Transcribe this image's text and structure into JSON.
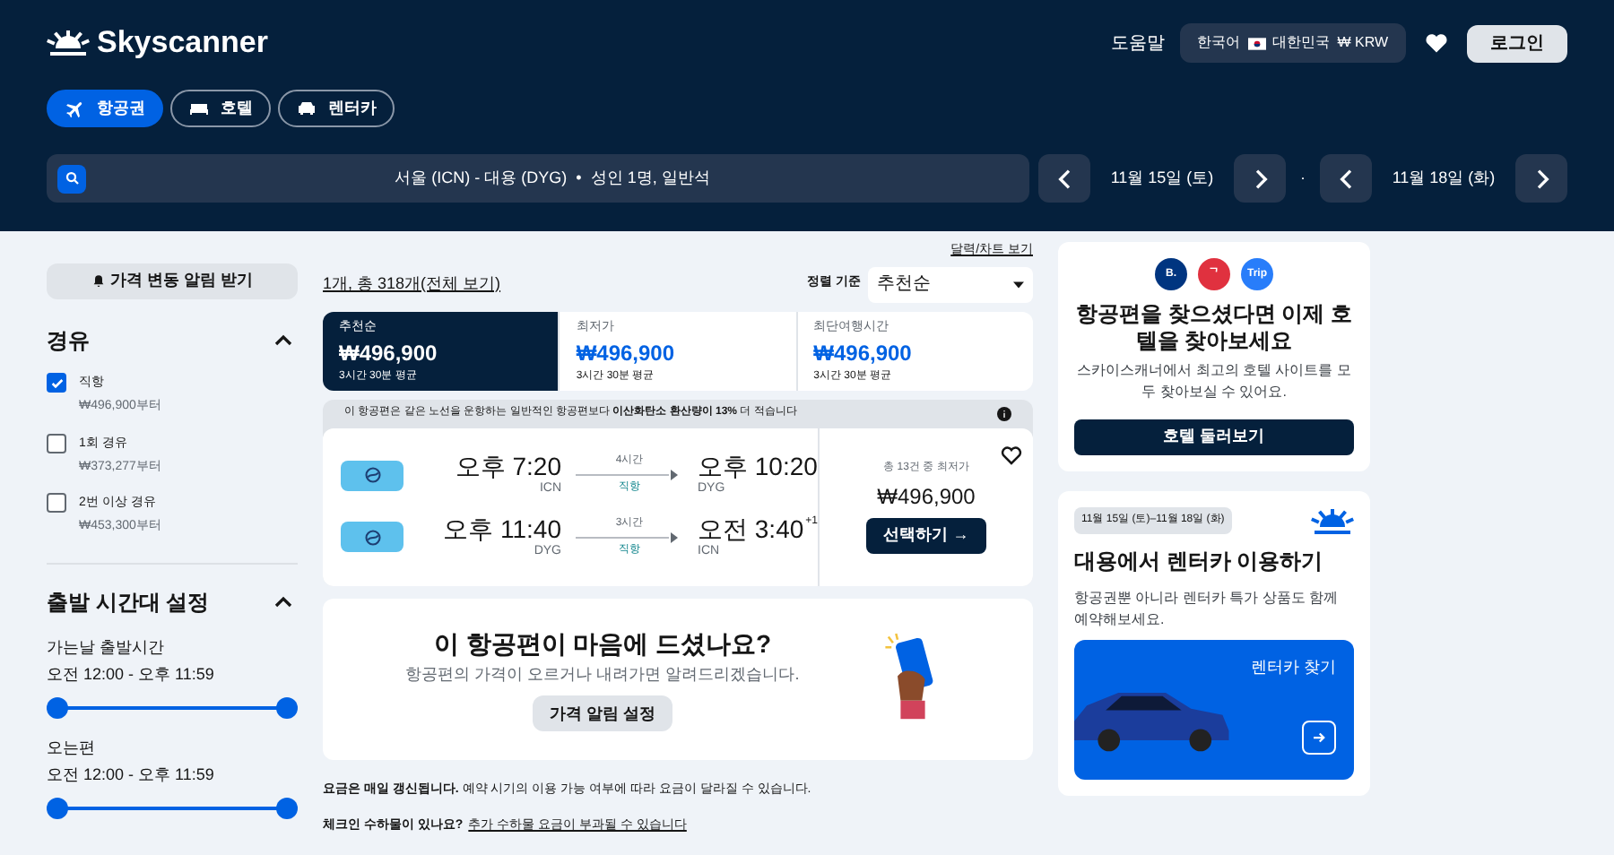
{
  "header": {
    "logo": "Skyscanner",
    "help": "도움말",
    "locale": {
      "language": "한국어",
      "country": "대한민국",
      "currency": "₩ KRW"
    },
    "login": "로그인"
  },
  "nav_tabs": [
    {
      "label": "항공권",
      "selected": true,
      "kind": "plane"
    },
    {
      "label": "호텔",
      "selected": false,
      "kind": "bed"
    },
    {
      "label": "렌터카",
      "selected": false,
      "kind": "car"
    }
  ],
  "search": {
    "summary": "서울 (ICN) - 대용 (DYG)  •  성인 1명, 일반석",
    "depart": "11월 15일 (토)",
    "separator": "·",
    "return": "11월 18일 (화)"
  },
  "sidebar": {
    "alert_button": "가격 변동 알림 받기",
    "stops": {
      "title": "경유",
      "expanded": true,
      "items": [
        {
          "label": "직항",
          "price": "₩496,900부터",
          "checked": true
        },
        {
          "label": "1회 경유",
          "price": "₩373,277부터",
          "checked": false
        },
        {
          "label": "2번 이상 경유",
          "price": "₩453,300부터",
          "checked": false
        }
      ]
    },
    "times": {
      "title": "출발 시간대 설정",
      "expanded": true,
      "sliders": [
        {
          "label": "가는날 출발시간",
          "range": "오전 12:00 - 오후 11:59",
          "level": 1
        },
        {
          "label": "오는편",
          "range": "오전 12:00 - 오후 11:59",
          "level": 1
        }
      ]
    }
  },
  "results": {
    "calendar_link": "달력/차트 보기",
    "count": "1개, 총 318개(전체 보기)",
    "sort_label": "정렬 기준",
    "sort_value": "추천순",
    "sort_tabs": [
      {
        "label": "추천순",
        "price": "₩496,900",
        "duration": "3시간 30분 평균",
        "selected": true
      },
      {
        "label": "최저가",
        "price": "₩496,900",
        "duration": "3시간 30분 평균",
        "selected": false
      },
      {
        "label": "최단여행시간",
        "price": "₩496,900",
        "duration": "3시간 30분 평균",
        "selected": false
      }
    ],
    "eco_banner": "이 항공편은 같은 노선을 운항하는 일반적인 항공편보다 **이산화탄소 환산량이 13%** 더 적습니다",
    "flight": {
      "legs": [
        {
          "depart_time": "오후 7:20",
          "depart_airport": "ICN",
          "duration": "4시간",
          "stops": "직항",
          "arrive_time": "오후 10:20",
          "arrive_airport": "DYG"
        },
        {
          "depart_time": "오후 11:40",
          "depart_airport": "DYG",
          "duration": "3시간",
          "stops": "직항",
          "arrive_time": "오전 3:40",
          "day_offset": "+1",
          "arrive_airport": "ICN"
        }
      ],
      "deals": "총 13건 중 최저가",
      "price": "₩496,900",
      "select": "선택하기 →",
      "saved": false
    },
    "alert_card": {
      "title": "이 항공편이 마음에 드셨나요?",
      "text": "항공편의 가격이 오르거나 내려가면 알려드리겠습니다.",
      "button": "가격 알림 설정"
    },
    "notes": [
      {
        "text": "**요금은 매일 갱신됩니다.** 예약 시기의 이용 가능 여부에 따라 요금이 달라질 수 있습니다."
      },
      {
        "text": "**체크인 수하물이 있나요?**",
        "link": "추가 수하물 요금이 부과될 수 있습니다"
      }
    ]
  },
  "hotel_card": {
    "partners": [
      {
        "label": "B.",
        "color": "#003580"
      },
      {
        "label": "ᄀ",
        "color": "#e0313f"
      },
      {
        "label": "Trip",
        "color": "#287dfa"
      }
    ],
    "title": "항공편을 찾으셨다면 이제 호텔을 찾아보세요",
    "text": "스카이스캐너에서 최고의 호텔 사이트를 모두 찾아보실 수 있어요.",
    "button": "호텔 둘러보기"
  },
  "car_card": {
    "dates": "11월 15일 (토)–11월 18일 (화)",
    "title": "대용에서 렌터카 이용하기",
    "text": "항공권뿐 아니라 렌터카 특가 상품도 함께 예약해보세요.",
    "cta": "렌터카 찾기"
  }
}
